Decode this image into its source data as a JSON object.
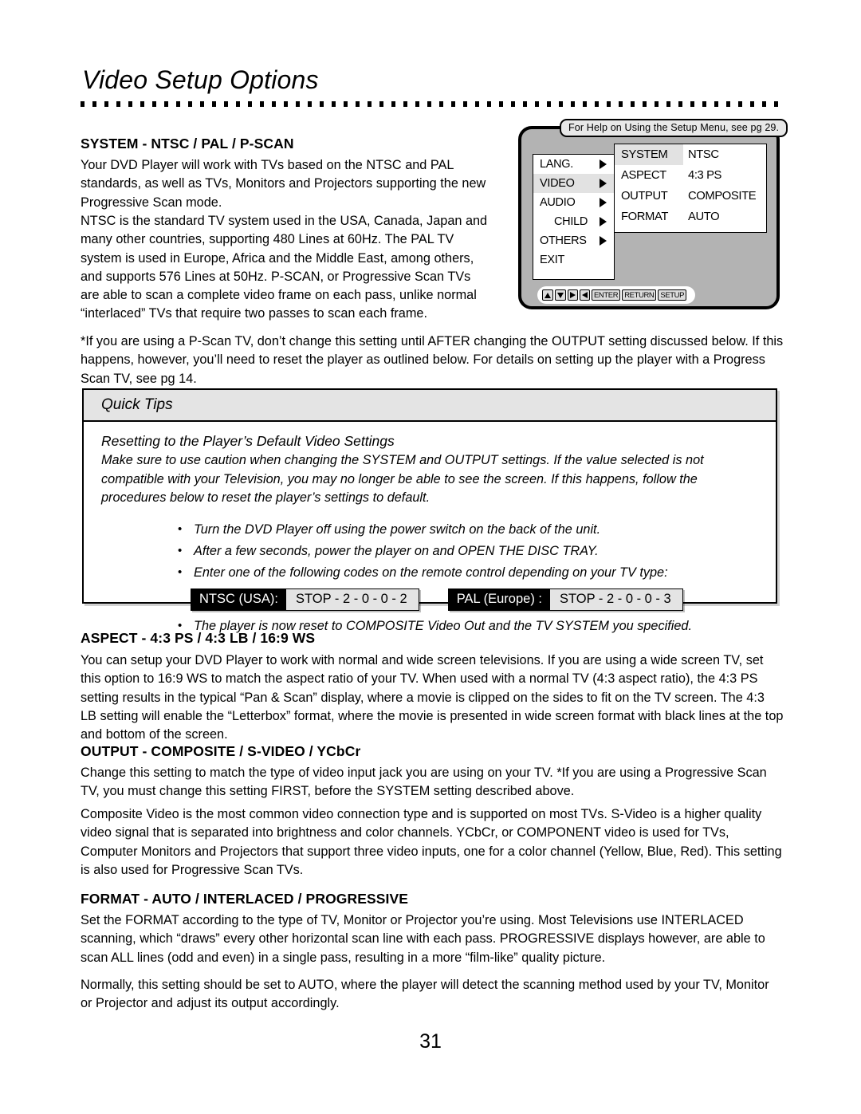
{
  "page": {
    "title": "Video Setup Options",
    "number": "31"
  },
  "sections": {
    "system": {
      "heading": "SYSTEM - NTSC / PAL / P-SCAN",
      "p1": "Your DVD Player will work with TVs based on the NTSC and PAL standards, as well as TVs, Monitors and Projectors supporting the new Progressive Scan mode.",
      "p2": "NTSC is the standard TV system used in the USA, Canada, Japan and many other countries, supporting 480 Lines at 60Hz. The PAL TV system is used in Europe, Africa and the Middle East, among others, and supports 576 Lines at 50Hz. P-SCAN, or Progressive Scan TVs are able to scan a complete video frame on each pass, unlike normal “interlaced” TVs that require two passes to scan each frame.",
      "footnote": "*If you are using a P-Scan TV, don’t change this setting until AFTER changing the OUTPUT setting discussed below. If this happens, however, you’ll need to reset the player as outlined below. For details on setting up the player with a Progress Scan TV, see pg 14."
    },
    "aspect": {
      "heading": "ASPECT - 4:3 PS / 4:3 LB / 16:9 WS",
      "p1": "You can setup your DVD Player to work with normal and wide screen televisions. If you are using a wide screen TV, set this option to 16:9 WS to match the aspect ratio of your TV. When used with a normal TV (4:3 aspect ratio), the 4:3 PS setting results in the typical “Pan & Scan” display, where a movie is clipped on the sides to fit on the TV screen. The 4:3 LB setting will enable the “Letterbox” format, where the movie is presented in wide screen format with black lines at the top and bottom of the screen."
    },
    "output": {
      "heading": "OUTPUT - COMPOSITE / S-VIDEO / YCbCr",
      "p1": "Change this setting to match the type of video input jack you are using on your TV. *If you are using a Progressive Scan TV, you must change this setting FIRST, before the SYSTEM setting described above.",
      "p2": "Composite Video is the most common video connection type and is supported on most TVs. S-Video is a higher quality video signal that is separated into brightness and color channels. YCbCr, or COMPONENT video is used for TVs, Computer Monitors and Projectors that support three video inputs, one for a color channel (Yellow, Blue, Red). This setting is also used for Progressive Scan TVs."
    },
    "format": {
      "heading": "FORMAT - AUTO / INTERLACED / PROGRESSIVE",
      "p1": "Set the FORMAT according to the type of TV, Monitor or Projector you’re using. Most Televisions use INTERLACED scanning, which “draws” every other horizontal scan line with each pass. PROGRESSIVE displays however, are able to scan ALL lines (odd and even) in a single pass, resulting in a more “film-like” quality picture.",
      "p2": "Normally, this setting should be set to AUTO, where the player will detect the scanning method used by your TV, Monitor or Projector and adjust its output accordingly."
    }
  },
  "setup_menu": {
    "help_tooltip": "For Help on Using the Setup Menu, see pg 29.",
    "left_items": [
      {
        "label": "LANG.",
        "has_arrow": true,
        "highlighted": false,
        "indent": false
      },
      {
        "label": "VIDEO",
        "has_arrow": true,
        "highlighted": true,
        "indent": false
      },
      {
        "label": "AUDIO",
        "has_arrow": true,
        "highlighted": false,
        "indent": false
      },
      {
        "label": "CHILD",
        "has_arrow": true,
        "highlighted": false,
        "indent": true
      },
      {
        "label": "OTHERS",
        "has_arrow": true,
        "highlighted": false,
        "indent": false
      },
      {
        "label": "EXIT",
        "has_arrow": false,
        "highlighted": false,
        "indent": false
      }
    ],
    "options": [
      {
        "name": "SYSTEM",
        "value": "NTSC",
        "highlighted": true
      },
      {
        "name": "ASPECT",
        "value": "4:3 PS",
        "highlighted": false
      },
      {
        "name": "OUTPUT",
        "value": "COMPOSITE",
        "highlighted": false
      },
      {
        "name": "FORMAT",
        "value": "AUTO",
        "highlighted": false
      }
    ],
    "nav_keys": [
      {
        "type": "triangle",
        "dir": "up",
        "label": ""
      },
      {
        "type": "triangle",
        "dir": "down",
        "label": ""
      },
      {
        "type": "triangle",
        "dir": "right",
        "label": ""
      },
      {
        "type": "triangle",
        "dir": "left",
        "label": ""
      },
      {
        "type": "text",
        "dir": "",
        "label": "ENTER"
      },
      {
        "type": "text",
        "dir": "",
        "label": "RETURN"
      },
      {
        "type": "text",
        "dir": "",
        "label": "SETUP"
      }
    ]
  },
  "quick_tips": {
    "header": "Quick Tips",
    "subtitle": "Resetting to the Player’s Default Video Settings",
    "intro": "Make sure to use caution when changing the SYSTEM and OUTPUT settings. If the value selected is not compatible with your Television, you may no longer be able to see the screen. If this happens, follow the procedures below to reset the player’s settings to default.",
    "bullets_before": [
      "Turn the DVD Player off using the power switch on the back of the unit.",
      "After a few seconds, power the player on and OPEN THE DISC TRAY.",
      "Enter one of the following codes on the remote control depending on your TV type:"
    ],
    "codes": [
      {
        "key": "NTSC (USA):",
        "value": "STOP - 2 - 0 - 0 - 2"
      },
      {
        "key": "PAL (Europe) :",
        "value": "STOP - 2 - 0 - 0 - 3"
      }
    ],
    "bullets_after": [
      "The player is now reset to COMPOSITE Video Out and the TV SYSTEM you specified."
    ]
  },
  "colors": {
    "tv_frame_bg": "#b3b3b3",
    "menu_highlight": "#e2e2e2",
    "tips_header_bg": "#e4e4e4",
    "code_value_bg": "#e4e4e4",
    "code_key_bg": "#000000"
  }
}
